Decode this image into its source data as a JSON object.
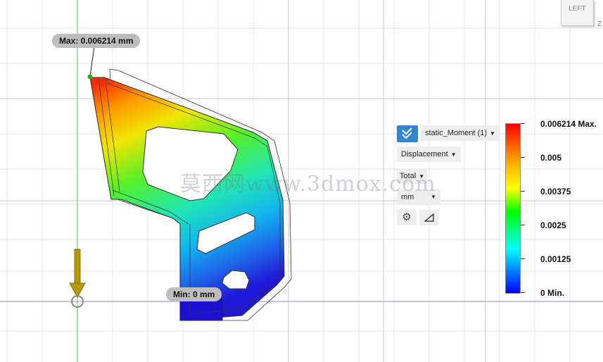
{
  "colors": {
    "max_color": "#ff0000",
    "min_color": "#0000ff",
    "panel_accent": "#2f86d1",
    "grid": "#e2e2e2",
    "x_axis_line": "#a9b3e0",
    "y_axis_line": "#8fd18f",
    "constraint_arrow": "#b89a00"
  },
  "probes": {
    "max_label": "Max: 0.006214 mm",
    "min_label": "Min: 0 mm"
  },
  "viewcube": {
    "face_label": "LEFT",
    "axis_label": "Z"
  },
  "results_panel": {
    "study": "static_Moment (1)",
    "result_type": "Displacement",
    "component": "Total",
    "unit": "mm",
    "settings_icon": "gear-icon",
    "probe_icon": "triangle-icon"
  },
  "legend": {
    "labels": [
      "0.006214 Max.",
      "0.005",
      "0.00375",
      "0.0025",
      "0.00125",
      "0 Min."
    ]
  },
  "watermark": "莫西网www.3dmox.com"
}
